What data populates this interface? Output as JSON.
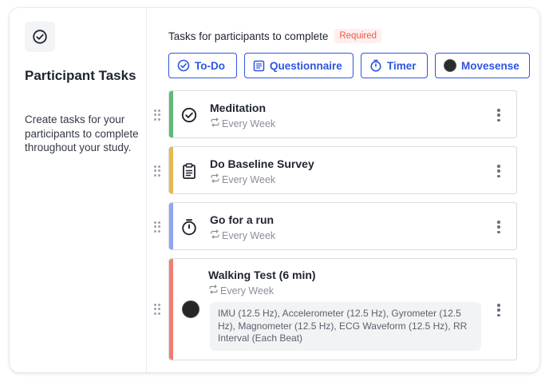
{
  "sidebar": {
    "icon": "check-circle-icon",
    "title": "Participant Tasks",
    "description": "Create tasks for your participants to complete throughout your study."
  },
  "main": {
    "heading": "Tasks for participants to complete",
    "required_badge": "Required",
    "add_buttons": [
      {
        "label": "To-Do",
        "icon": "check-circle-icon"
      },
      {
        "label": "Questionnaire",
        "icon": "list-icon"
      },
      {
        "label": "Timer",
        "icon": "timer-icon"
      },
      {
        "label": "Movesense",
        "icon": "movesense-device-icon"
      }
    ],
    "tasks": [
      {
        "name": "Meditation",
        "recurrence": "Every Week",
        "icon": "check-circle-icon",
        "color": "#5fb87a"
      },
      {
        "name": "Do Baseline Survey",
        "recurrence": "Every Week",
        "icon": "clipboard-icon",
        "color": "#e8b84f"
      },
      {
        "name": "Go for a run",
        "recurrence": "Every Week",
        "icon": "timer-icon",
        "color": "#8ea6f2"
      },
      {
        "name": "Walking Test (6 min)",
        "recurrence": "Every Week",
        "icon": "movesense-device-icon",
        "color": "#f07f6f",
        "sensors": "IMU (12.5 Hz), Accelerometer (12.5 Hz), Gyrometer (12.5 Hz), Magnometer (12.5 Hz), ECG Waveform (12.5 Hz), RR Interval (Each Beat)"
      }
    ]
  },
  "colors": {
    "accent": "#2f55e0",
    "required": "#ef5a4a"
  }
}
